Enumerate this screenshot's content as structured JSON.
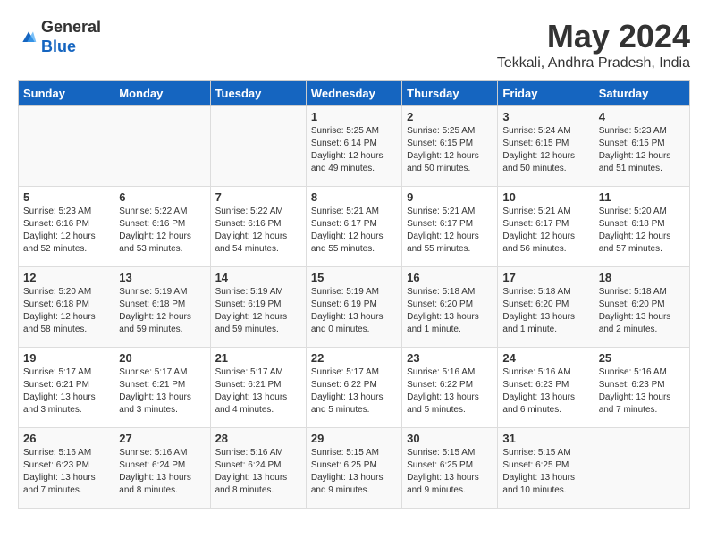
{
  "header": {
    "logo_line1": "General",
    "logo_line2": "Blue",
    "title": "May 2024",
    "subtitle": "Tekkali, Andhra Pradesh, India"
  },
  "days_of_week": [
    "Sunday",
    "Monday",
    "Tuesday",
    "Wednesday",
    "Thursday",
    "Friday",
    "Saturday"
  ],
  "weeks": [
    [
      {
        "day": "",
        "info": ""
      },
      {
        "day": "",
        "info": ""
      },
      {
        "day": "",
        "info": ""
      },
      {
        "day": "1",
        "info": "Sunrise: 5:25 AM\nSunset: 6:14 PM\nDaylight: 12 hours\nand 49 minutes."
      },
      {
        "day": "2",
        "info": "Sunrise: 5:25 AM\nSunset: 6:15 PM\nDaylight: 12 hours\nand 50 minutes."
      },
      {
        "day": "3",
        "info": "Sunrise: 5:24 AM\nSunset: 6:15 PM\nDaylight: 12 hours\nand 50 minutes."
      },
      {
        "day": "4",
        "info": "Sunrise: 5:23 AM\nSunset: 6:15 PM\nDaylight: 12 hours\nand 51 minutes."
      }
    ],
    [
      {
        "day": "5",
        "info": "Sunrise: 5:23 AM\nSunset: 6:16 PM\nDaylight: 12 hours\nand 52 minutes."
      },
      {
        "day": "6",
        "info": "Sunrise: 5:22 AM\nSunset: 6:16 PM\nDaylight: 12 hours\nand 53 minutes."
      },
      {
        "day": "7",
        "info": "Sunrise: 5:22 AM\nSunset: 6:16 PM\nDaylight: 12 hours\nand 54 minutes."
      },
      {
        "day": "8",
        "info": "Sunrise: 5:21 AM\nSunset: 6:17 PM\nDaylight: 12 hours\nand 55 minutes."
      },
      {
        "day": "9",
        "info": "Sunrise: 5:21 AM\nSunset: 6:17 PM\nDaylight: 12 hours\nand 55 minutes."
      },
      {
        "day": "10",
        "info": "Sunrise: 5:21 AM\nSunset: 6:17 PM\nDaylight: 12 hours\nand 56 minutes."
      },
      {
        "day": "11",
        "info": "Sunrise: 5:20 AM\nSunset: 6:18 PM\nDaylight: 12 hours\nand 57 minutes."
      }
    ],
    [
      {
        "day": "12",
        "info": "Sunrise: 5:20 AM\nSunset: 6:18 PM\nDaylight: 12 hours\nand 58 minutes."
      },
      {
        "day": "13",
        "info": "Sunrise: 5:19 AM\nSunset: 6:18 PM\nDaylight: 12 hours\nand 59 minutes."
      },
      {
        "day": "14",
        "info": "Sunrise: 5:19 AM\nSunset: 6:19 PM\nDaylight: 12 hours\nand 59 minutes."
      },
      {
        "day": "15",
        "info": "Sunrise: 5:19 AM\nSunset: 6:19 PM\nDaylight: 13 hours\nand 0 minutes."
      },
      {
        "day": "16",
        "info": "Sunrise: 5:18 AM\nSunset: 6:20 PM\nDaylight: 13 hours\nand 1 minute."
      },
      {
        "day": "17",
        "info": "Sunrise: 5:18 AM\nSunset: 6:20 PM\nDaylight: 13 hours\nand 1 minute."
      },
      {
        "day": "18",
        "info": "Sunrise: 5:18 AM\nSunset: 6:20 PM\nDaylight: 13 hours\nand 2 minutes."
      }
    ],
    [
      {
        "day": "19",
        "info": "Sunrise: 5:17 AM\nSunset: 6:21 PM\nDaylight: 13 hours\nand 3 minutes."
      },
      {
        "day": "20",
        "info": "Sunrise: 5:17 AM\nSunset: 6:21 PM\nDaylight: 13 hours\nand 3 minutes."
      },
      {
        "day": "21",
        "info": "Sunrise: 5:17 AM\nSunset: 6:21 PM\nDaylight: 13 hours\nand 4 minutes."
      },
      {
        "day": "22",
        "info": "Sunrise: 5:17 AM\nSunset: 6:22 PM\nDaylight: 13 hours\nand 5 minutes."
      },
      {
        "day": "23",
        "info": "Sunrise: 5:16 AM\nSunset: 6:22 PM\nDaylight: 13 hours\nand 5 minutes."
      },
      {
        "day": "24",
        "info": "Sunrise: 5:16 AM\nSunset: 6:23 PM\nDaylight: 13 hours\nand 6 minutes."
      },
      {
        "day": "25",
        "info": "Sunrise: 5:16 AM\nSunset: 6:23 PM\nDaylight: 13 hours\nand 7 minutes."
      }
    ],
    [
      {
        "day": "26",
        "info": "Sunrise: 5:16 AM\nSunset: 6:23 PM\nDaylight: 13 hours\nand 7 minutes."
      },
      {
        "day": "27",
        "info": "Sunrise: 5:16 AM\nSunset: 6:24 PM\nDaylight: 13 hours\nand 8 minutes."
      },
      {
        "day": "28",
        "info": "Sunrise: 5:16 AM\nSunset: 6:24 PM\nDaylight: 13 hours\nand 8 minutes."
      },
      {
        "day": "29",
        "info": "Sunrise: 5:15 AM\nSunset: 6:25 PM\nDaylight: 13 hours\nand 9 minutes."
      },
      {
        "day": "30",
        "info": "Sunrise: 5:15 AM\nSunset: 6:25 PM\nDaylight: 13 hours\nand 9 minutes."
      },
      {
        "day": "31",
        "info": "Sunrise: 5:15 AM\nSunset: 6:25 PM\nDaylight: 13 hours\nand 10 minutes."
      },
      {
        "day": "",
        "info": ""
      }
    ]
  ]
}
